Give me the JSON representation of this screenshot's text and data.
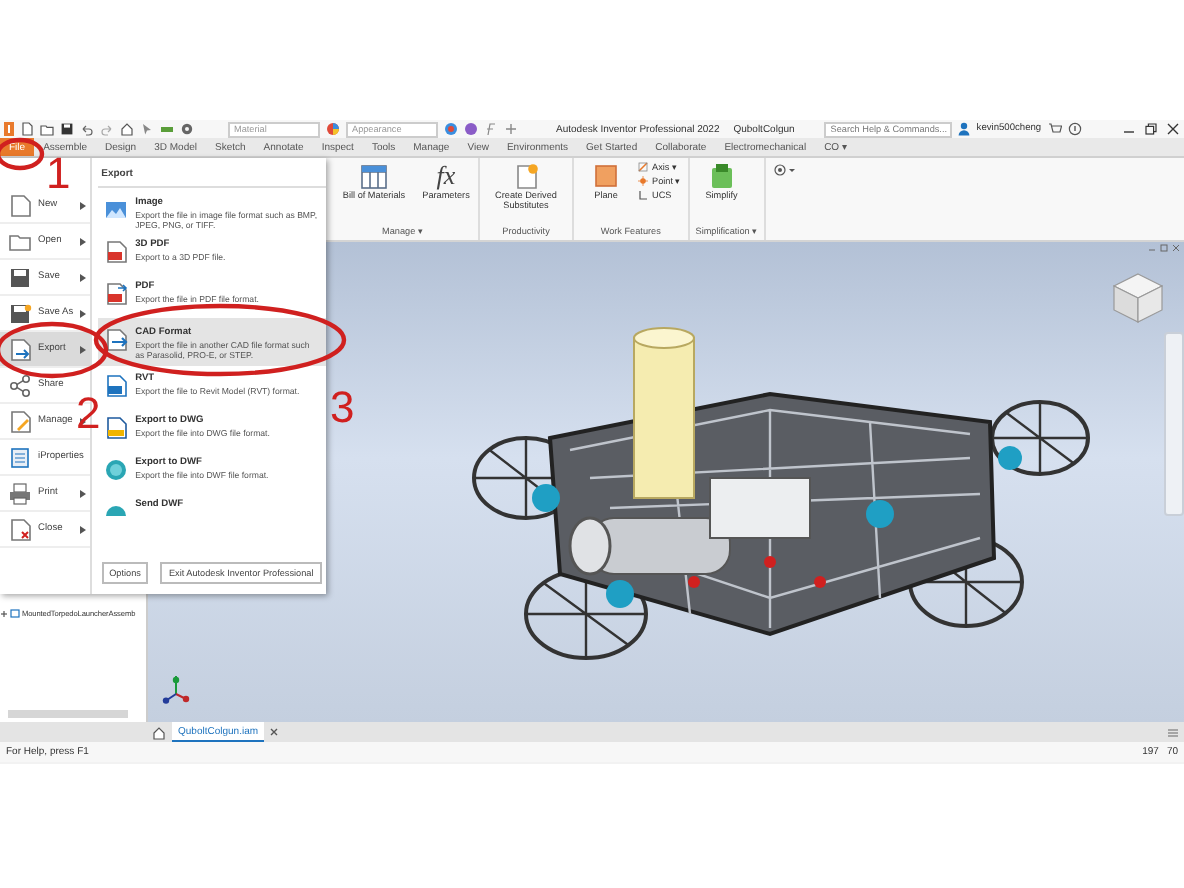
{
  "quick_access": {
    "material": "Material",
    "appearance": "Appearance"
  },
  "window": {
    "title": "Autodesk Inventor Professional 2022",
    "document": "QuboltColgun"
  },
  "search": {
    "placeholder": "Search Help & Commands..."
  },
  "user": {
    "name": "kevin500cheng"
  },
  "ribbon_tabs": [
    {
      "label": "File",
      "selected": true
    },
    {
      "label": "Assemble",
      "selected": false
    },
    {
      "label": "Design",
      "selected": false
    },
    {
      "label": "3D Model",
      "selected": false
    },
    {
      "label": "Sketch",
      "selected": false
    },
    {
      "label": "Annotate",
      "selected": false
    },
    {
      "label": "Inspect",
      "selected": false
    },
    {
      "label": "Tools",
      "selected": false
    },
    {
      "label": "Manage",
      "selected": false
    },
    {
      "label": "View",
      "selected": false
    },
    {
      "label": "Environments",
      "selected": false
    },
    {
      "label": "Get Started",
      "selected": false
    },
    {
      "label": "Collaborate",
      "selected": false
    },
    {
      "label": "Electromechanical",
      "selected": false
    },
    {
      "label": "CO ▾",
      "selected": false
    }
  ],
  "ribbon_groups": [
    {
      "label": "Manage ▾",
      "tools": [
        {
          "label": "Bill of Materials",
          "kind": "large"
        },
        {
          "label": "Parameters",
          "kind": "large",
          "glyph": "fx"
        }
      ]
    },
    {
      "label": "Productivity",
      "tools": [
        {
          "label": "Create Derived Substitutes",
          "kind": "large"
        }
      ]
    },
    {
      "label": "Work Features",
      "tools": [
        {
          "label": "Plane",
          "kind": "large"
        },
        {
          "label": "Axis ▾",
          "kind": "small"
        },
        {
          "label": "Point ▾",
          "kind": "small"
        },
        {
          "label": "UCS",
          "kind": "small"
        }
      ]
    },
    {
      "label": "Simplification ▾",
      "tools": [
        {
          "label": "Simplify",
          "kind": "large"
        }
      ]
    }
  ],
  "file_menu": {
    "items": [
      {
        "label": "New",
        "submenu": true,
        "selected": false
      },
      {
        "label": "Open",
        "submenu": true,
        "selected": false
      },
      {
        "label": "Save",
        "submenu": true,
        "selected": false
      },
      {
        "label": "Save As",
        "submenu": true,
        "selected": false
      },
      {
        "label": "Export",
        "submenu": true,
        "selected": true
      },
      {
        "label": "Share",
        "submenu": false,
        "selected": false
      },
      {
        "label": "Manage",
        "submenu": true,
        "selected": false
      },
      {
        "label": "iProperties",
        "submenu": false,
        "selected": false
      },
      {
        "label": "Print",
        "submenu": true,
        "selected": false
      },
      {
        "label": "Close",
        "submenu": true,
        "selected": false
      }
    ],
    "panel": {
      "title": "Export",
      "items": [
        {
          "title": "Image",
          "description": "Export the file in image file format such as BMP, JPEG, PNG, or TIFF.",
          "selected": false
        },
        {
          "title": "3D PDF",
          "description": "Export to a 3D PDF file.",
          "selected": false
        },
        {
          "title": "PDF",
          "description": "Export the file in PDF file format.",
          "selected": false
        },
        {
          "title": "CAD Format",
          "description": "Export the file in another CAD file format such as Parasolid, PRO-E, or STEP.",
          "selected": true
        },
        {
          "title": "RVT",
          "description": "Export the file to Revit Model (RVT) format.",
          "selected": false
        },
        {
          "title": "Export to DWG",
          "description": "Export the file into DWG file format.",
          "selected": false
        },
        {
          "title": "Export to DWF",
          "description": "Export the file into DWF file format.",
          "selected": false
        },
        {
          "title": "Send DWF",
          "selected": false
        }
      ]
    },
    "buttons": [
      "Options",
      "Exit Autodesk Inventor Professional"
    ]
  },
  "browser": {
    "items": [
      {
        "label": "MountedTorpedoLauncherAssemb",
        "expanded": false
      }
    ]
  },
  "document_tabs": [
    {
      "label": "QuboltColgun.iam",
      "selected": true
    }
  ],
  "status_bar": {
    "message": "For Help, press F1",
    "values": [
      "197",
      "70"
    ]
  },
  "annotations": [
    {
      "label": "1"
    },
    {
      "label": "2"
    },
    {
      "label": "3"
    }
  ]
}
